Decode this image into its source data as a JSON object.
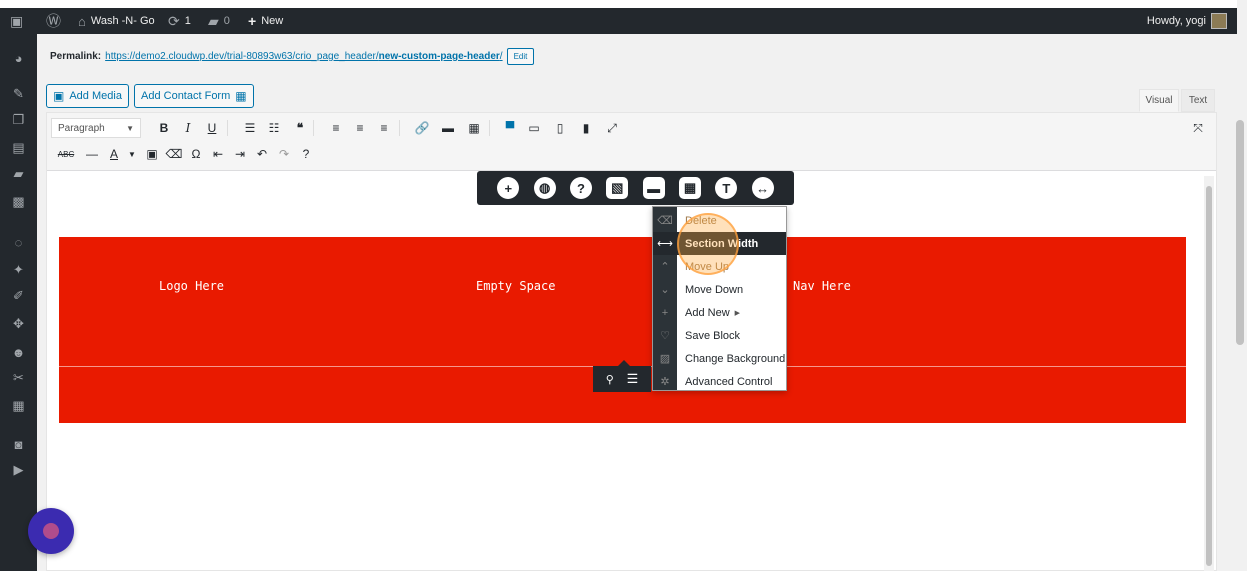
{
  "adminbar": {
    "site_name": "Wash -N- Go",
    "updates_count": "1",
    "comments_count": "0",
    "new_label": "New",
    "howdy": "Howdy, yogi"
  },
  "permalink": {
    "label": "Permalink:",
    "url_base": "https://demo2.cloudwp.dev/trial-80893w63/crio_page_header/",
    "url_slug": "new-custom-page-header",
    "url_tail": "/",
    "edit_label": "Edit"
  },
  "media": {
    "add_media": "Add Media",
    "add_contact_form": "Add Contact Form"
  },
  "editor_tabs": {
    "visual": "Visual",
    "text": "Text"
  },
  "toolbar": {
    "format_value": "Paragraph",
    "bold": "B",
    "italic": "I",
    "underline": "U",
    "omega": "Ω"
  },
  "section": {
    "col1": "Logo Here",
    "col2": "Empty Space",
    "col3": "Nav Here"
  },
  "context_menu": {
    "items": [
      {
        "label": "Delete"
      },
      {
        "label": "Section Width"
      },
      {
        "label": "Move Up"
      },
      {
        "label": "Move Down"
      },
      {
        "label": "Add New"
      },
      {
        "label": "Save Block"
      },
      {
        "label": "Change Background"
      },
      {
        "label": "Advanced Control"
      }
    ]
  },
  "colors": {
    "section_bg": "#e91a00",
    "admin_dark": "#23282d",
    "link_blue": "#0073aa",
    "highlight": "#ffa03c"
  }
}
